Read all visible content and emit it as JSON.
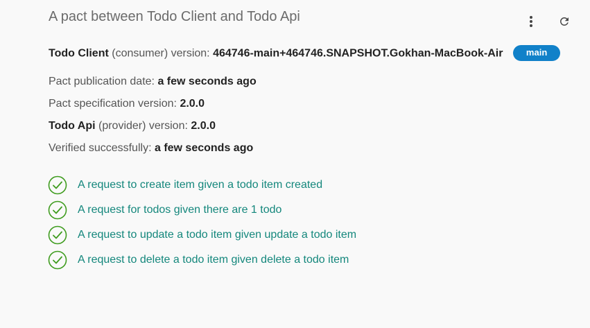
{
  "header": {
    "title": "A pact between Todo Client and Todo Api",
    "more_icon": "more-vertical-icon",
    "refresh_icon": "refresh-icon"
  },
  "consumer": {
    "name": "Todo Client",
    "role": "(consumer) version:",
    "version": "464746-main+464746.SNAPSHOT.Gokhan-MacBook-Air",
    "branch_badge": "main"
  },
  "publication": {
    "label": "Pact publication date:",
    "value": "a few seconds ago"
  },
  "specification": {
    "label": "Pact specification version:",
    "value": "2.0.0"
  },
  "provider": {
    "name": "Todo Api",
    "role": "(provider) version:",
    "version": "2.0.0"
  },
  "verification": {
    "label": "Verified successfully:",
    "value": "a few seconds ago"
  },
  "interactions": [
    {
      "label": "A request to create item given a todo item created",
      "status": "verified"
    },
    {
      "label": "A request for todos given there are 1 todo",
      "status": "verified"
    },
    {
      "label": "A request to update a todo item given update a todo item",
      "status": "verified"
    },
    {
      "label": "A request to delete a todo item given delete a todo item",
      "status": "verified"
    }
  ],
  "colors": {
    "background": "#f9f9f9",
    "badge": "#1181c9",
    "link": "#14877c",
    "check": "#3f9c1f"
  }
}
